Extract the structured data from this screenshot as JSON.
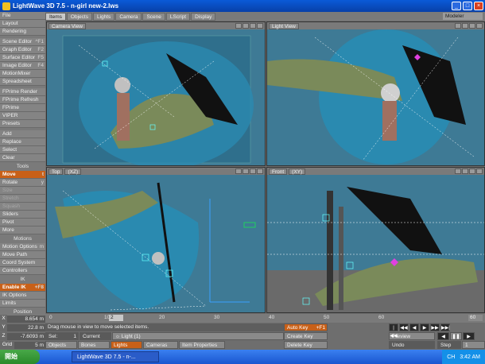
{
  "window": {
    "title": "LightWave 3D 7.5 - n-girl new-2.lws"
  },
  "tabs": [
    "Items",
    "Objects",
    "Lights",
    "Camera",
    "Scene",
    "LScript",
    "Display"
  ],
  "modeler_label": "Modeler",
  "left_menu": {
    "top_items": [
      {
        "label": "File",
        "shortcut": ""
      },
      {
        "label": "Layout",
        "shortcut": ""
      },
      {
        "label": "Rendering",
        "shortcut": ""
      },
      {
        "label": "Scene Editor",
        "shortcut": "^F1"
      },
      {
        "label": "Graph Editor",
        "shortcut": "F2"
      },
      {
        "label": "Surface Editor",
        "shortcut": "F5"
      },
      {
        "label": "Image Editor",
        "shortcut": "F4"
      },
      {
        "label": "MotionMixer",
        "shortcut": ""
      },
      {
        "label": "Spreadsheet",
        "shortcut": ""
      },
      {
        "label": "FPrime Render",
        "shortcut": ""
      },
      {
        "label": "FPrime Refresh",
        "shortcut": ""
      },
      {
        "label": "FPrime",
        "shortcut": ""
      },
      {
        "label": "VIPER",
        "shortcut": ""
      },
      {
        "label": "Presets",
        "shortcut": ""
      },
      {
        "label": "Add",
        "shortcut": ""
      },
      {
        "label": "Replace",
        "shortcut": ""
      },
      {
        "label": "Select",
        "shortcut": ""
      },
      {
        "label": "Clear",
        "shortcut": ""
      }
    ],
    "tools_header": "Tools",
    "tools": [
      {
        "label": "Move",
        "shortcut": "t",
        "state": "on"
      },
      {
        "label": "Rotate",
        "shortcut": "y",
        "state": ""
      },
      {
        "label": "Size",
        "shortcut": "",
        "state": "dim"
      },
      {
        "label": "Stretch",
        "shortcut": "",
        "state": "dim"
      },
      {
        "label": "Squash",
        "shortcut": "",
        "state": "dim"
      },
      {
        "label": "Sliders",
        "shortcut": "",
        "state": ""
      },
      {
        "label": "Pivot",
        "shortcut": "",
        "state": ""
      },
      {
        "label": "More",
        "shortcut": "",
        "state": ""
      }
    ],
    "motions_header": "Motions",
    "motions": [
      {
        "label": "Motion Options",
        "shortcut": "m"
      },
      {
        "label": "Move Path",
        "shortcut": ""
      },
      {
        "label": "Coord System",
        "shortcut": ""
      },
      {
        "label": "Controllers",
        "shortcut": ""
      }
    ],
    "ik_header": "IK",
    "ik": [
      {
        "label": "Enable IK",
        "shortcut": "+F8",
        "state": "on"
      },
      {
        "label": "IK Options",
        "shortcut": "",
        "state": ""
      },
      {
        "label": "Limits",
        "shortcut": "",
        "state": ""
      }
    ],
    "position_header": "Position"
  },
  "viewports": [
    {
      "label": "Camera View"
    },
    {
      "label": "Light View"
    },
    {
      "label": "Top",
      "axes": "(XZ)"
    },
    {
      "label": "Front",
      "axes": "(XY)"
    }
  ],
  "position": {
    "x": "8.654 m",
    "y": "22.8 m",
    "z": "-7.6093 m"
  },
  "grid": {
    "label": "Grid",
    "value": "5 m"
  },
  "timeline": {
    "ticks": [
      "0",
      "10",
      "20",
      "30",
      "40",
      "50",
      "60"
    ],
    "current_frame": "2",
    "end_frame": "60"
  },
  "status_text": "Drag mouse in view to move selected items.",
  "controls": {
    "sel_label": "Sel:",
    "sel_value": "1",
    "current_item_label": "Current Item",
    "current_item_value": "Light (1)",
    "objects": "Objects",
    "bones": "Bones",
    "lights": "Lights",
    "cameras": "Cameras",
    "item_properties": "Item Properties",
    "auto_key": "Auto Key",
    "auto_key_shortcut": "+F1",
    "create_key": "Create Key",
    "delete_key": "Delete Key",
    "preview": "Preview",
    "step_label": "Step",
    "step_value": "1",
    "undo": "Undo"
  },
  "taskbar": {
    "start": "開始",
    "active_window": "LightWave 3D 7.5 - n-...",
    "tray_lang": "CH",
    "clock": "3:42 AM"
  }
}
